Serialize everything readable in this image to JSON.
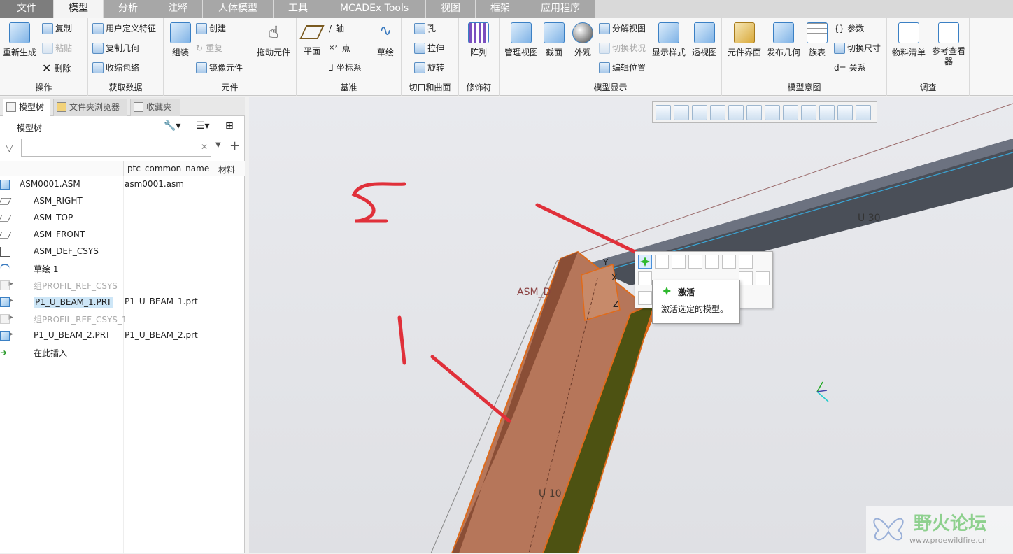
{
  "menu": {
    "tabs": [
      "文件",
      "模型",
      "分析",
      "注释",
      "人体模型",
      "工具",
      "MCADEx Tools",
      "视图",
      "框架",
      "应用程序"
    ]
  },
  "ribbon": {
    "operations": {
      "label": "操作",
      "regen": "重新生成",
      "copy": "复制",
      "paste": "粘贴",
      "delete": "删除"
    },
    "get_data": {
      "label": "获取数据",
      "udf": "用户定义特征",
      "copy_geom": "复制几何",
      "shrinkwrap": "收缩包络"
    },
    "component": {
      "label": "元件",
      "assemble": "组装",
      "create": "创建",
      "repeat": "重复",
      "mirror": "镜像元件",
      "drag": "拖动元件"
    },
    "datum": {
      "label": "基准",
      "plane": "平面",
      "axis": "轴",
      "point": "点",
      "csys": "坐标系",
      "sketch": "草绘"
    },
    "cut_surface": {
      "label": "切口和曲面",
      "hole": "孔",
      "extrude": "拉伸",
      "revolve": "旋转"
    },
    "modifiers": {
      "label": "修饰符",
      "pattern": "阵列"
    },
    "model_display": {
      "label": "模型显示",
      "manage_views": "管理视图",
      "section": "截面",
      "appearance": "外观",
      "explode": "分解视图",
      "toggle_status": "切换状况",
      "edit_position": "编辑位置",
      "display_style": "显示样式",
      "perspective": "透视图"
    },
    "model_intent": {
      "label": "模型意图",
      "comp_interface": "元件界面",
      "publish_geom": "发布几何",
      "family_table": "族表",
      "params": "参数",
      "switch_dims": "切换尺寸",
      "relations": "关系"
    },
    "investigate": {
      "label": "调查",
      "bom": "物料清单",
      "ref_viewer": "参考查看器"
    }
  },
  "left_panel": {
    "tabs": [
      "模型树",
      "文件夹浏览器",
      "收藏夹"
    ],
    "title": "模型树",
    "columns": [
      "ptc_common_name",
      "材料"
    ],
    "items": [
      {
        "name": "ASM0001.ASM",
        "common": "asm0001.asm",
        "icon": "assembly-icon"
      },
      {
        "name": "ASM_RIGHT",
        "common": "",
        "icon": "datum-plane-icon"
      },
      {
        "name": "ASM_TOP",
        "common": "",
        "icon": "datum-plane-icon"
      },
      {
        "name": "ASM_FRONT",
        "common": "",
        "icon": "datum-plane-icon"
      },
      {
        "name": "ASM_DEF_CSYS",
        "common": "",
        "icon": "csys-icon"
      },
      {
        "name": "草绘 1",
        "common": "",
        "icon": "sketch-icon"
      },
      {
        "name": "组PROFIL_REF_CSYS",
        "common": "",
        "icon": "group-icon"
      },
      {
        "name": "P1_U_BEAM_1.PRT",
        "common": "P1_U_BEAM_1.prt",
        "icon": "part-icon"
      },
      {
        "name": "组PROFIL_REF_CSYS_1",
        "common": "",
        "icon": "group-icon"
      },
      {
        "name": "P1_U_BEAM_2.PRT",
        "common": "P1_U_BEAM_2.prt",
        "icon": "part-icon"
      },
      {
        "name": "在此插入",
        "common": "",
        "icon": "insert-here-icon"
      }
    ]
  },
  "viewport": {
    "beam_label_top": "U 30",
    "beam_label_bottom": "U 10",
    "datum_label": "ASM_D",
    "axis_y": "Y",
    "axis_x": "X",
    "axis_z": "Z",
    "annotation_1": "1",
    "annotation_2": "2",
    "annotation_color": "#e0303a"
  },
  "tooltip": {
    "title": "激活",
    "desc": "激活选定的模型。"
  },
  "watermark": {
    "text": "野火论坛",
    "url": "www.proewildfire.cn"
  }
}
